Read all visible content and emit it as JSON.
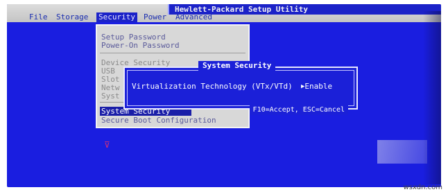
{
  "title": "Hewlett-Packard Setup Utility",
  "menu": [
    "File",
    "Storage",
    "Security",
    "Power",
    "Advanced"
  ],
  "active_menu_index": 2,
  "dropdown": {
    "items": [
      {
        "label": "Setup Password",
        "state": "normal"
      },
      {
        "label": "Power-On Password",
        "state": "normal"
      },
      {
        "label": "Device Security",
        "state": "dim"
      },
      {
        "label": "USB",
        "state": "dim"
      },
      {
        "label": "Slot",
        "state": "dim"
      },
      {
        "label": "Netw",
        "state": "dim"
      },
      {
        "label": "Syst",
        "state": "dim"
      },
      {
        "label": "System Security",
        "state": "selected"
      },
      {
        "label": "Secure Boot Configuration",
        "state": "normal"
      }
    ]
  },
  "dialog": {
    "title": "System Security",
    "setting_label": "Virtualization Technology (VTx/VTd)",
    "setting_value": "Enable",
    "value_arrow_icon": "right-triangle-icon",
    "hint": "F10=Accept, ESC=Cancel"
  },
  "watermark": "wsxdn.com",
  "colors": {
    "screen_bg": "#1a1ee0",
    "menubar_bg": "#c4c4c4",
    "selection": "#1a1ea8",
    "dialog_bg": "#1b20d8"
  }
}
